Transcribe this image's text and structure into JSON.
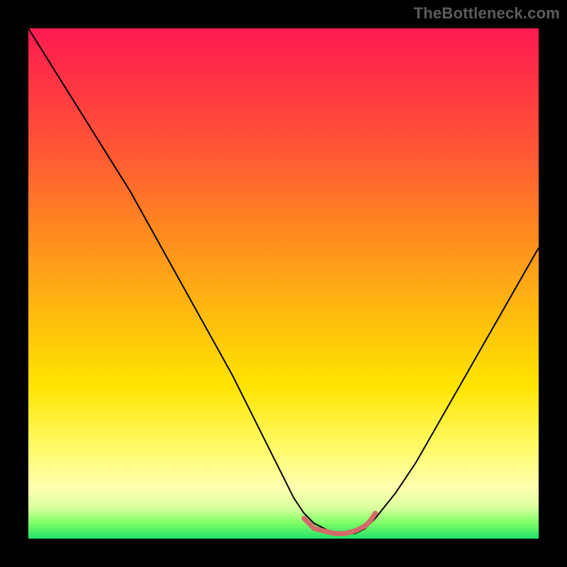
{
  "watermark": {
    "text": "TheBottleneck.com"
  },
  "chart_data": {
    "type": "line",
    "title": "",
    "xlabel": "",
    "ylabel": "",
    "xlim": [
      0,
      100
    ],
    "ylim": [
      0,
      100
    ],
    "legend": false,
    "grid": false,
    "background_gradient_stops": [
      {
        "pos": 0,
        "color": "#ff1a52"
      },
      {
        "pos": 8,
        "color": "#ff2e46"
      },
      {
        "pos": 25,
        "color": "#ff5a33"
      },
      {
        "pos": 40,
        "color": "#ff8a1f"
      },
      {
        "pos": 55,
        "color": "#ffb810"
      },
      {
        "pos": 70,
        "color": "#ffe400"
      },
      {
        "pos": 82,
        "color": "#fffb66"
      },
      {
        "pos": 90,
        "color": "#ffffb0"
      },
      {
        "pos": 94,
        "color": "#d9ff9e"
      },
      {
        "pos": 97,
        "color": "#7dff66"
      },
      {
        "pos": 100,
        "color": "#22e06a"
      }
    ],
    "series": [
      {
        "name": "bottleneck-curve",
        "color": "#000000",
        "stroke_width": 2,
        "x": [
          0,
          5,
          10,
          15,
          20,
          25,
          30,
          35,
          40,
          45,
          50,
          52,
          54,
          56,
          58,
          60,
          62,
          64,
          66,
          68,
          72,
          76,
          80,
          84,
          88,
          92,
          96,
          100
        ],
        "values": [
          100,
          92,
          84,
          76,
          68,
          59,
          50,
          41,
          32,
          22,
          12,
          8,
          5,
          3,
          2,
          1,
          1,
          1,
          2,
          4,
          9,
          15,
          22,
          29,
          36,
          43,
          50,
          57
        ]
      },
      {
        "name": "minimum-band",
        "color": "#d46a6a",
        "stroke_width": 7,
        "stroke_linecap": "round",
        "x": [
          54,
          56,
          58,
          60,
          62,
          64,
          66,
          67,
          68
        ],
        "values": [
          4,
          2,
          1.5,
          1,
          1,
          1.5,
          2.5,
          3.5,
          5
        ]
      }
    ]
  }
}
